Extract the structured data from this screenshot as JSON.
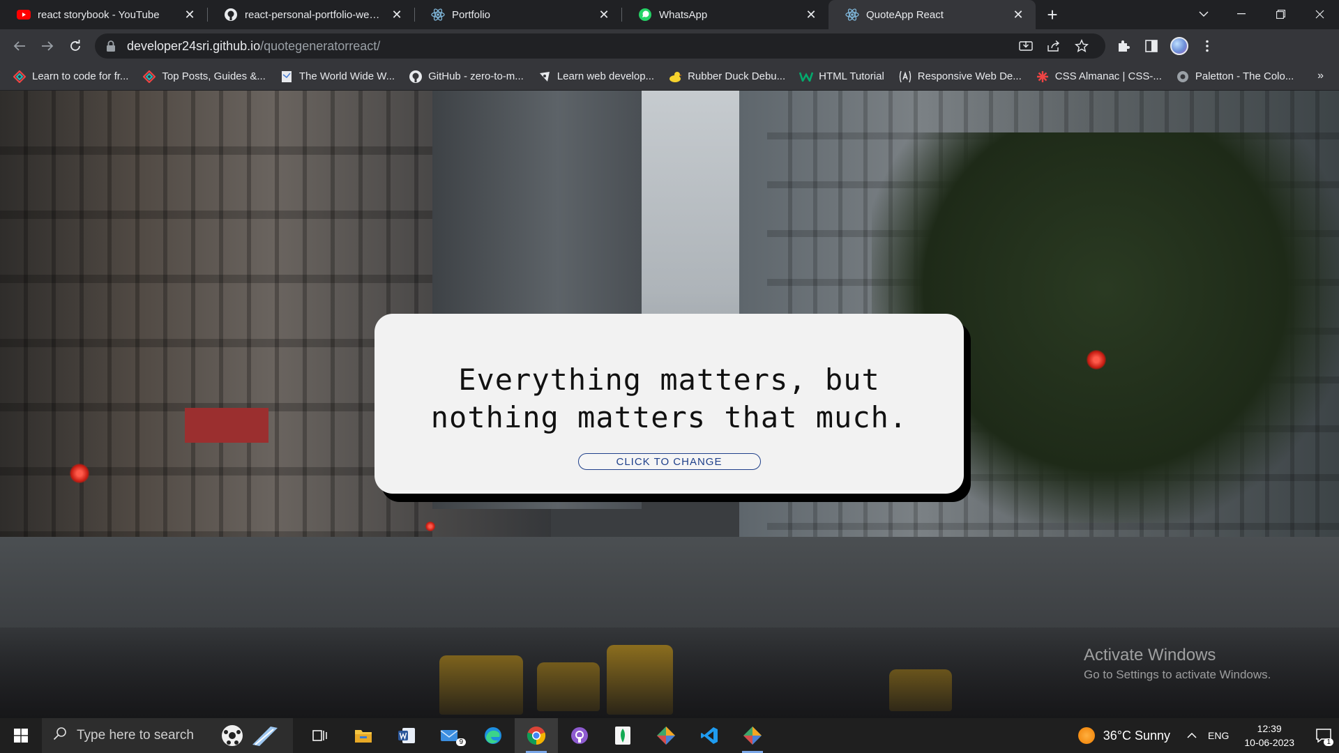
{
  "tabs": [
    {
      "title": "react storybook - YouTube",
      "icon": "youtube-icon",
      "active": false
    },
    {
      "title": "react-personal-portfolio-website",
      "icon": "github-icon",
      "active": false
    },
    {
      "title": "Portfolio",
      "icon": "react-icon",
      "active": false
    },
    {
      "title": "WhatsApp",
      "icon": "whatsapp-icon",
      "active": false
    },
    {
      "title": "QuoteApp React",
      "icon": "react-icon",
      "active": true
    }
  ],
  "toolbar": {
    "url_host": "developer24sri.github.io",
    "url_path": "/quotegeneratorreact/"
  },
  "bookmarks": [
    {
      "label": "Learn to code for fr...",
      "icon": "freecodecamp-icon"
    },
    {
      "label": "Top Posts, Guides &...",
      "icon": "dev-icon"
    },
    {
      "label": "The World Wide W...",
      "icon": "page-icon"
    },
    {
      "label": "GitHub - zero-to-m...",
      "icon": "github-icon"
    },
    {
      "label": "Learn web develop...",
      "icon": "mdn-icon"
    },
    {
      "label": "Rubber Duck Debu...",
      "icon": "duck-icon"
    },
    {
      "label": "HTML Tutorial",
      "icon": "w3schools-icon"
    },
    {
      "label": "Responsive Web De...",
      "icon": "a-icon"
    },
    {
      "label": "CSS Almanac | CSS-...",
      "icon": "csstricks-icon"
    },
    {
      "label": "Paletton - The Colo...",
      "icon": "paletton-icon"
    }
  ],
  "content": {
    "quote": "Everything matters, but nothing matters that much.",
    "button_label": "CLICK TO CHANGE"
  },
  "watermark": {
    "title": "Activate Windows",
    "subtitle": "Go to Settings to activate Windows."
  },
  "taskbar": {
    "search_placeholder": "Type here to search",
    "mail_badge": "9",
    "weather": "36°C  Sunny",
    "language": "ENG",
    "time": "12:39",
    "date": "10-06-2023",
    "notification_count": "1"
  },
  "colors": {
    "accent_button": "#1e3f8a",
    "card_bg": "#f2f2f2",
    "chrome_dark": "#202124",
    "chrome_toolbar": "#35363a"
  }
}
